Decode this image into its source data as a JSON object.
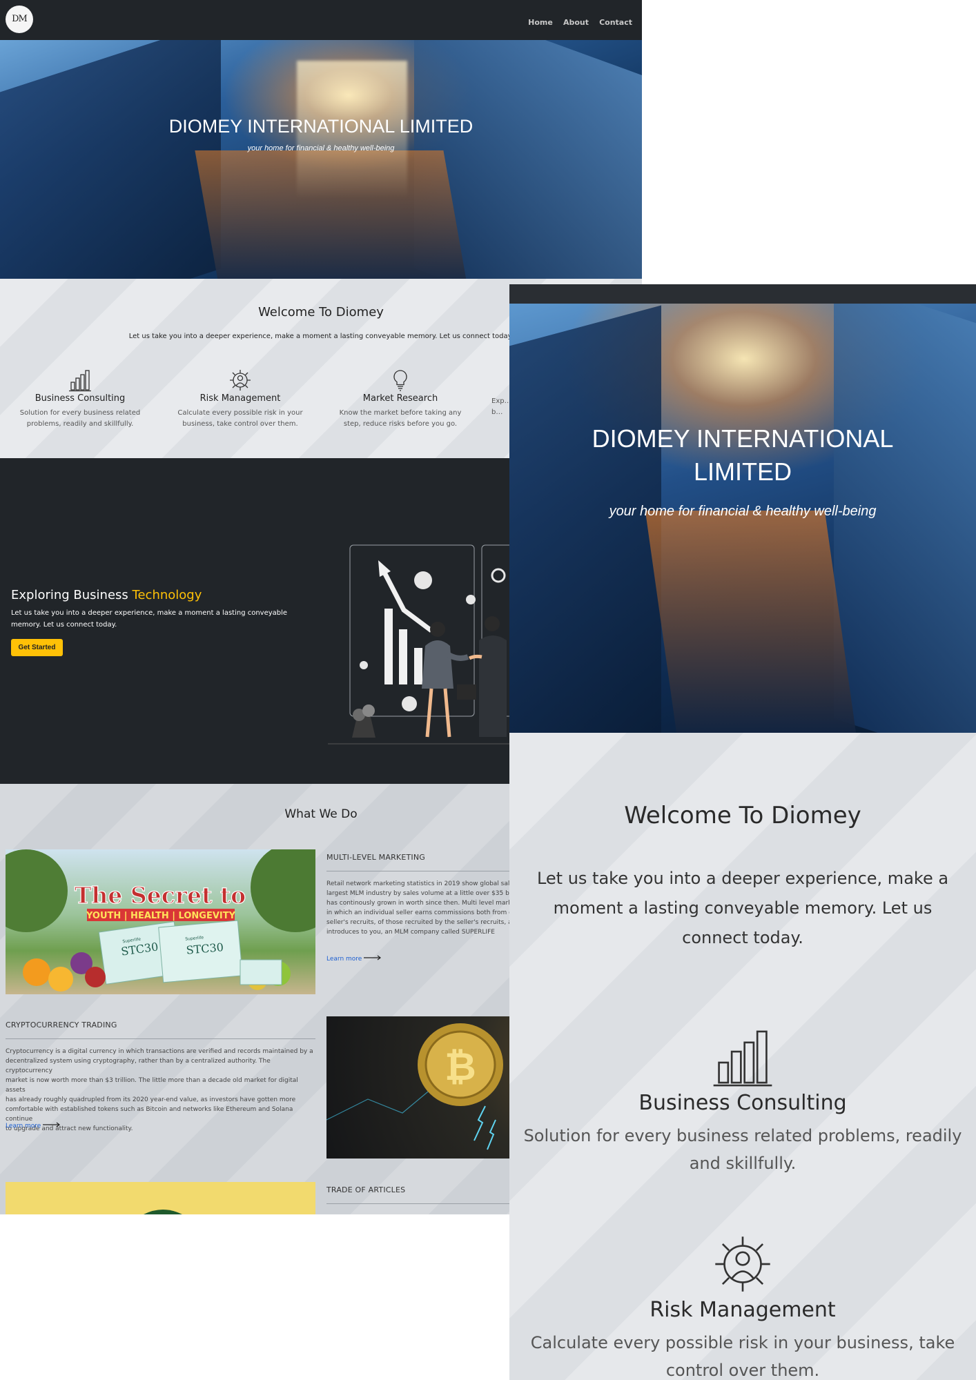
{
  "logo": {
    "text": "DM"
  },
  "nav": {
    "items": [
      "Home",
      "About",
      "Contact"
    ]
  },
  "hero": {
    "title": "DIOMEY INTERNATIONAL LIMITED",
    "subtitle": "your home for financial & healthy well-being"
  },
  "welcome": {
    "title": "Welcome To Diomey",
    "text": "Let us take you into a deeper experience, make a moment a lasting conveyable memory. Let us connect today.",
    "features": [
      {
        "title": "Business Consulting",
        "desc": "Solution for every business related problems, readily and skillfully.",
        "icon": "bar-chart-icon"
      },
      {
        "title": "Risk Management",
        "desc": "Calculate every possible risk in your business, take control over them.",
        "icon": "gear-person-icon"
      },
      {
        "title": "Market Research",
        "desc": "Know the market before taking any step, reduce risks before you go.",
        "icon": "lightbulb-icon"
      },
      {
        "title": "",
        "desc": "Exp… b…",
        "icon": ""
      }
    ]
  },
  "explore": {
    "title_prefix": "Exploring Business ",
    "title_highlight": "Technology",
    "text": "Let us take you into a deeper experience, make a moment a lasting conveyable memory. Let us connect today.",
    "button": "Get Started"
  },
  "whatwedo": {
    "title": "What We Do",
    "sections": [
      {
        "heading": "MULTI-LEVEL MARKETING",
        "lines": [
          "Retail network marketing statistics in 2019 show global sale…",
          "largest MLM industry by sales volume at a little over $35 bill…",
          "has continously grown in worth since then. Multi level marke…",
          "in which an individual seller earns commissions both from di…",
          "seller's recruits, of those recruited by the seller's recruits, ar…",
          "introduces to you, an MLM company called SUPERLIFE"
        ],
        "link": "Learn more",
        "image": {
          "line1": "The Secret to",
          "line2": "YOUTH | HEALTH | LONGEVITY",
          "product": "STC30",
          "brand": "Superlife"
        }
      },
      {
        "heading": "CRYPTOCURRENCY TRADING",
        "lines": [
          "Cryptocurrency is a digital currency in which transactions are verified and records maintained by a",
          "decentralized system using cryptography, rather than by a centralized authority. The cryptocurrency",
          "market is now worth more than $3 trillion. The little more than a decade old market for digital assets",
          "has already roughly quadrupled from its 2020 year-end value, as investors have gotten more",
          "comfortable with established tokens such as Bitcoin and networks like Ethereum and Solana continue",
          "to upgrade and attract new functionality."
        ],
        "link": "Learn more"
      },
      {
        "heading": "TRADE OF ARTICLES"
      }
    ]
  },
  "zoom": {
    "hero_title": "DIOMEY INTERNATIONAL LIMITED",
    "hero_subtitle": "your home for financial & healthy well-being",
    "welcome_title": "Welcome To Diomey",
    "welcome_text": "Let us take you into a deeper experience, make a moment a lasting conveyable memory. Let us connect today.",
    "features": [
      {
        "title": "Business Consulting",
        "desc": "Solution for every business related problems, readily and skillfully."
      },
      {
        "title": "Risk Management",
        "desc": "Calculate every possible risk in your business, take control over them."
      }
    ]
  },
  "colors": {
    "accent": "#ffc107",
    "dark": "#212529",
    "link": "#1d5fd1"
  }
}
